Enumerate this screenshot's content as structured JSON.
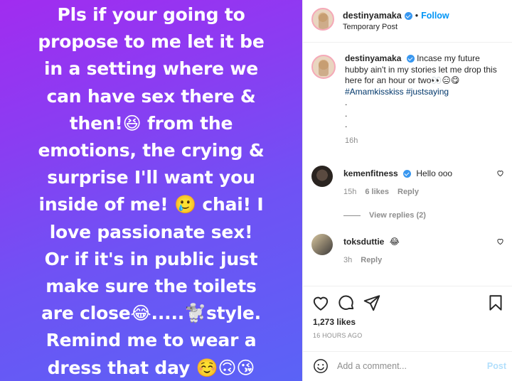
{
  "story": {
    "text": "Pls if your going to\npropose to me let it be\nin a setting where we\ncan have sex there &\nthen!😆 from the\nemotions, the crying  &\nsurprise I'll want you\ninside of me! 🥲 chai! I\nlove passionate sex!\nOr if it's in public just\nmake sure the toilets\nare close😂.....🐩style.\nRemind me to wear a\ndress that day ☺️🙃😘"
  },
  "header": {
    "username": "destinyamaka",
    "separator": "•",
    "follow_label": "Follow",
    "subtitle": "Temporary Post"
  },
  "caption": {
    "username": "destinyamaka",
    "text": "Incase my future hubby ain't in my stories let me drop this here for an hour or two👀😑😋",
    "hashtags": "#Amamkisskiss #justsaying",
    "dots": ".\n.\n.",
    "time": "16h"
  },
  "comments": [
    {
      "username": "kemenfitness",
      "text": "Hello ooo",
      "time": "15h",
      "likes": "6 likes",
      "reply": "Reply",
      "view_replies": "View replies (2)"
    },
    {
      "username": "toksduttie",
      "text": "😂",
      "time": "3h",
      "reply": "Reply"
    }
  ],
  "actions": {
    "likes": "1,273 likes",
    "post_time": "16 HOURS AGO"
  },
  "add_comment": {
    "placeholder": "Add a comment...",
    "post_label": "Post"
  },
  "colors": {
    "accent": "#0095f6",
    "story_gradient_start": "#a12cf0",
    "story_gradient_end": "#5a63f6"
  }
}
